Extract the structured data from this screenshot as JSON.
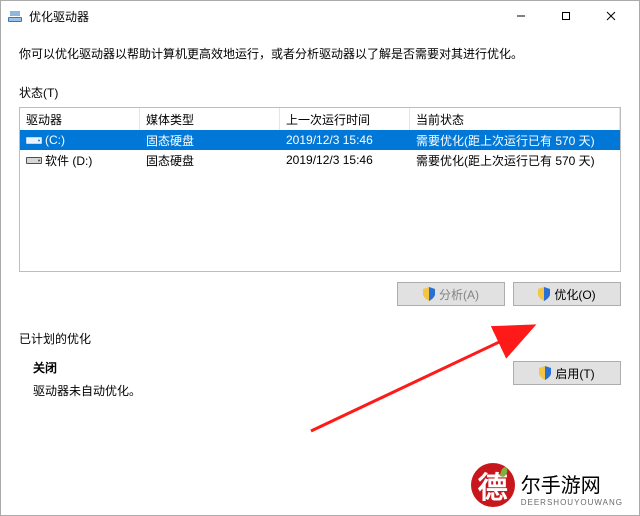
{
  "window": {
    "title": "优化驱动器"
  },
  "description": "你可以优化驱动器以帮助计算机更高效地运行，或者分析驱动器以了解是否需要对其进行优化。",
  "status_label": "状态(T)",
  "columns": {
    "drive": "驱动器",
    "media": "媒体类型",
    "last": "上一次运行时间",
    "status": "当前状态"
  },
  "drives": [
    {
      "name": "(C:)",
      "media": "固态硬盘",
      "last": "2019/12/3 15:46",
      "status": "需要优化(距上次运行已有 570 天)",
      "selected": true,
      "icon": "disk"
    },
    {
      "name": "软件 (D:)",
      "media": "固态硬盘",
      "last": "2019/12/3 15:46",
      "status": "需要优化(距上次运行已有 570 天)",
      "selected": false,
      "icon": "disk"
    }
  ],
  "buttons": {
    "analyze": "分析(A)",
    "optimize": "优化(O)",
    "enable": "启用(T)"
  },
  "schedule": {
    "label": "已计划的优化",
    "off": "关闭",
    "note": "驱动器未自动优化。"
  },
  "watermark": {
    "char": "德",
    "main": "尔手游网",
    "sub": "DEERSHOUYOUWANG"
  }
}
